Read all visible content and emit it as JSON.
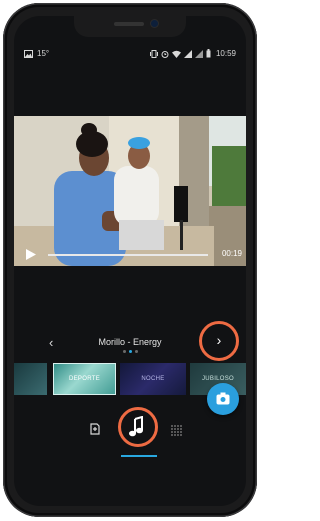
{
  "status_bar": {
    "left_label": "15°",
    "time": "10:59"
  },
  "player": {
    "time": "00:19",
    "progress": 0.82
  },
  "song": {
    "title": "Morillo - Energy",
    "prev_glyph": "‹",
    "next_glyph": "›"
  },
  "filters": {
    "items": [
      {
        "label": ""
      },
      {
        "label": "DEPORTE"
      },
      {
        "label": "NOCHE"
      },
      {
        "label": "JUBILOSO"
      }
    ]
  },
  "icons": {
    "status_left": [
      "image-icon",
      "temperature-icon"
    ],
    "status_right": [
      "vibrate-icon",
      "alarm-icon",
      "wifi-icon",
      "signal-icon",
      "signal-icon",
      "battery-icon"
    ],
    "toolbar": [
      "timeline-icon",
      "music-note-icon",
      "format-icon"
    ],
    "fab": "camera-icon"
  },
  "colors": {
    "accent": "#29a8e0",
    "highlight_ring": "#ee6b43",
    "fab": "#2a9fde"
  }
}
